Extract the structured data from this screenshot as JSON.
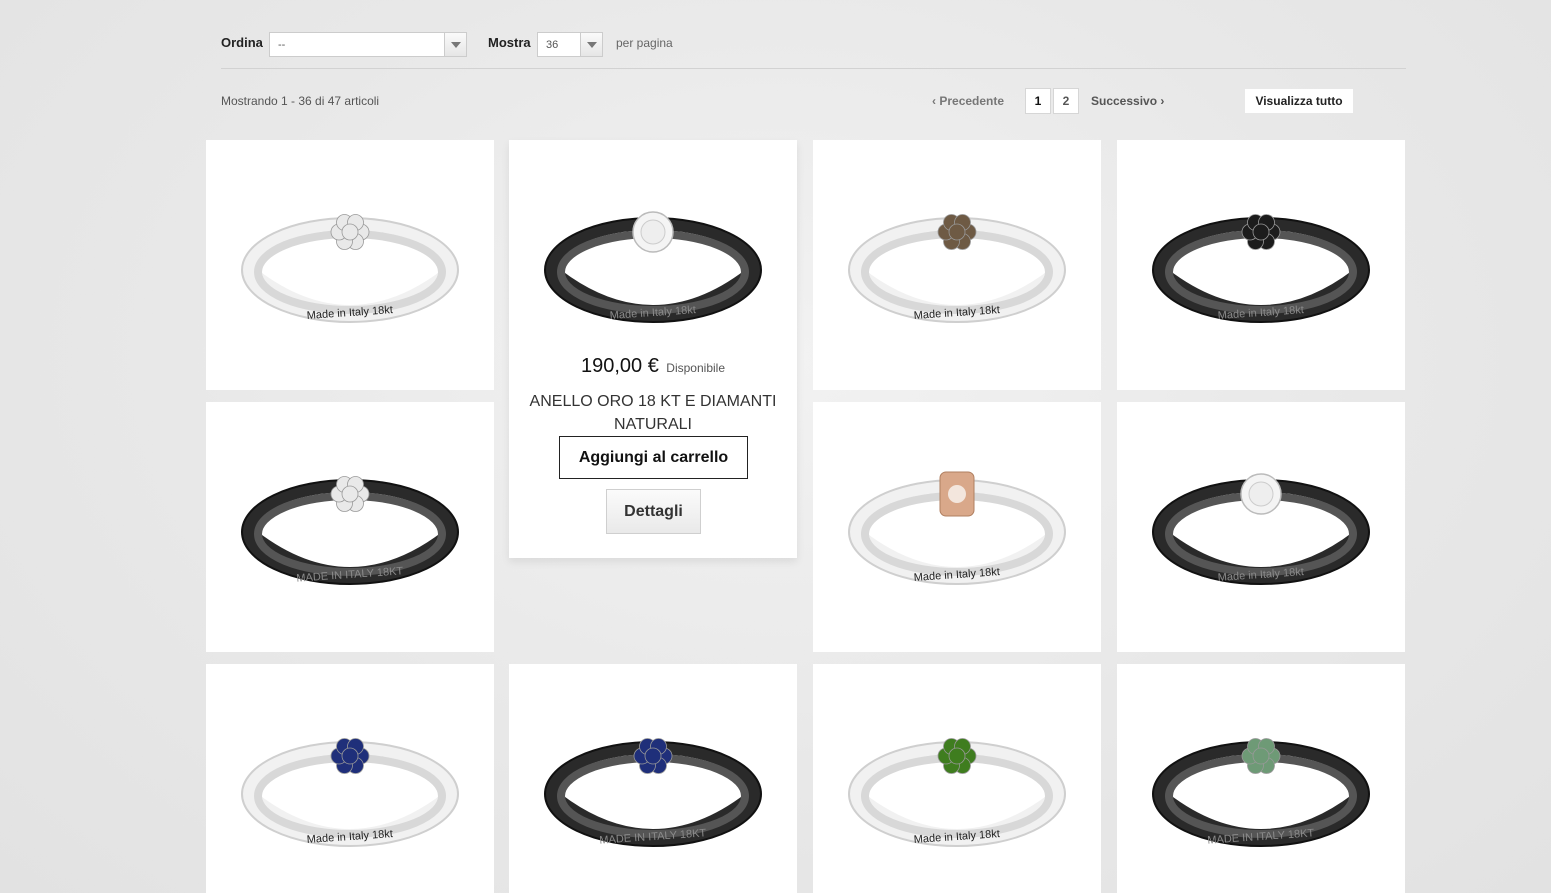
{
  "toolbar": {
    "sort_label": "Ordina",
    "sort_value": "--",
    "show_label": "Mostra",
    "show_value": "36",
    "per_page_label": "per pagina"
  },
  "results": {
    "summary": "Mostrando 1 - 36 di 47 articoli"
  },
  "pagination": {
    "prev_label": "Precedente",
    "pages": [
      "1",
      "2"
    ],
    "current_page": "1",
    "next_label": "Successivo",
    "view_all_label": "Visualizza tutto"
  },
  "hovered_product": {
    "price": "190,00 €",
    "availability": "Disponibile",
    "name": "ANELLO ORO 18 KT E DIAMANTI NATURALI",
    "add_to_cart_label": "Aggiungi al carrello",
    "details_label": "Dettagli"
  },
  "products": [
    {
      "band": "white",
      "stone": "diamond-white",
      "engraving": "Made in Italy 18kt"
    },
    {
      "band": "black",
      "stone": "solitaire-diamond",
      "engraving": "Made in Italy 18kt"
    },
    {
      "band": "white",
      "stone": "brown-diamond",
      "engraving": "Made in Italy 18kt"
    },
    {
      "band": "black",
      "stone": "black-diamond",
      "engraving": "Made in Italy 18kt"
    },
    {
      "band": "black",
      "stone": "diamond-white",
      "engraving": "MADE IN ITALY 18KT"
    },
    {
      "band": "white",
      "stone": "rose-gold-diamond",
      "engraving": "Made in Italy 18kt"
    },
    {
      "band": "black",
      "stone": "solitaire-diamond",
      "engraving": "Made in Italy 18kt"
    },
    {
      "band": "white",
      "stone": "blue-sapphire",
      "engraving": "Made in Italy 18kt"
    },
    {
      "band": "black",
      "stone": "blue-sapphire",
      "engraving": "MADE IN ITALY 18KT"
    },
    {
      "band": "white",
      "stone": "green-garnet",
      "engraving": "Made in Italy 18kt"
    },
    {
      "band": "black",
      "stone": "green-sapphire",
      "engraving": "MADE IN ITALY 18KT"
    }
  ],
  "colors": {
    "band_white": "#f1f1f1",
    "band_black": "#2a2a2a",
    "diamond-white": "#e9e9e9",
    "solitaire-diamond": "#eeeeee",
    "brown-diamond": "#6e5a44",
    "black-diamond": "#1c1c1c",
    "rose-gold-diamond": "#d9a88a",
    "blue-sapphire": "#1f2f7a",
    "green-garnet": "#3f7d1f",
    "green-sapphire": "#6e9a76"
  }
}
